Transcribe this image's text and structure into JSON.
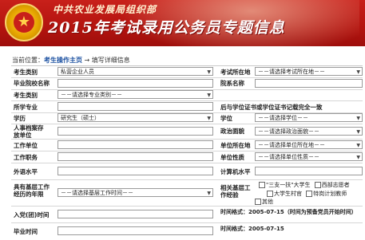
{
  "header": {
    "org": "中共农业发展局组织部",
    "title": "2015年考试录用公务员专题信息"
  },
  "breadcrumb": {
    "prefix": "当前位置：",
    "home": "考生操作主页",
    "arrow": "→",
    "current": "填写详细信息"
  },
  "fields": {
    "candidate_type_label": "考生类别",
    "candidate_type_value": "私营企业人员",
    "exam_location_label": "考试所在地",
    "exam_location_value": "－－请选择考试所在地－－",
    "school_name_label": "毕业院校名称",
    "college_label": "院系名称",
    "candidate_category_label": "考生类别",
    "candidate_category_value": "－－请选择专业类别－－",
    "degree_consistency_label": "后与学位证书或学位证书记载完全一致",
    "major_label": "所学专业",
    "education_label": "学历",
    "education_value": "研究生（硕士）",
    "degree_label": "学位",
    "degree_value": "－－请选择学位－－",
    "hr_archive_label": "人事档案存放单位",
    "political_label": "政治面貌",
    "political_value": "－－请选择政治面貌－－",
    "work_unit_label": "工作单位",
    "unit_location_label": "单位所在地",
    "unit_location_value": "－－请选择单位所在地－－",
    "job_title_label": "工作职务",
    "unit_nature_label": "单位性质",
    "unit_nature_value": "－－请选择单位性质－－",
    "foreign_lang_label": "外语水平",
    "computer_label": "计算机水平",
    "grassroots_label": "具有基层工作经历的年限",
    "grassroots_value": "－－请选择基层工作时间－－",
    "grassroots_type_label": "相关基层工作经验",
    "grassroots_options": [
      "\"三支一扶\"大学生",
      "西部志愿者",
      "大学生村官",
      "特岗计划教师",
      "其他"
    ],
    "party_time_label": "入党(团)时间",
    "party_time_hint": "时间格式：2005-07-15（时间为预备党员开始时间）",
    "graduation_label": "毕业时间",
    "graduation_hint": "时间格式：2005-07-15"
  }
}
